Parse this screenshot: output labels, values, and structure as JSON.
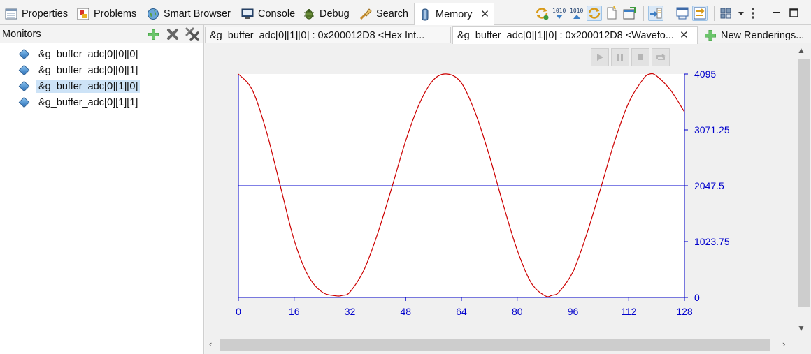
{
  "views": {
    "tabs": [
      {
        "label": "Properties"
      },
      {
        "label": "Problems"
      },
      {
        "label": "Smart Browser"
      },
      {
        "label": "Console"
      },
      {
        "label": "Debug"
      },
      {
        "label": "Search"
      },
      {
        "label": "Memory"
      }
    ]
  },
  "monitors": {
    "title": "Monitors",
    "items": [
      {
        "label": "&g_buffer_adc[0][0][0]"
      },
      {
        "label": "&g_buffer_adc[0][0][1]"
      },
      {
        "label": "&g_buffer_adc[0][1][0]"
      },
      {
        "label": "&g_buffer_adc[0][1][1]"
      }
    ]
  },
  "renderings": {
    "tabs": [
      {
        "label": "&g_buffer_adc[0][1][0] : 0x200012D8 <Hex Int..."
      },
      {
        "label": "&g_buffer_adc[0][1][0] : 0x200012D8 <Wavefo..."
      },
      {
        "label": "New Renderings..."
      }
    ]
  },
  "colors": {
    "waveform": "#cc0000",
    "axis": "#0000cc",
    "selection": "#cde3f7"
  },
  "chart_data": {
    "type": "line",
    "x_ticks": [
      0,
      16,
      32,
      48,
      64,
      80,
      96,
      112,
      128
    ],
    "y_ticks": [
      0,
      1023.75,
      2047.5,
      3071.25,
      4095
    ],
    "xlim": [
      0,
      128
    ],
    "ylim": [
      0,
      4095
    ],
    "y_axis_side": "right",
    "midline": 2047.5,
    "grid": false,
    "series": [
      {
        "x": [
          0,
          4,
          8,
          12,
          16,
          20,
          24,
          28,
          30,
          32,
          36,
          40,
          44,
          48,
          52,
          56,
          60,
          64,
          68,
          72,
          76,
          80,
          84,
          88,
          90,
          92,
          96,
          100,
          104,
          108,
          112,
          116,
          118,
          120,
          124,
          128
        ],
        "y": [
          4095,
          3800,
          3050,
          2050,
          1050,
          400,
          100,
          30,
          40,
          100,
          500,
          1180,
          2010,
          2870,
          3560,
          3990,
          4095,
          3930,
          3380,
          2600,
          1700,
          870,
          270,
          30,
          40,
          100,
          470,
          1170,
          2010,
          2870,
          3570,
          3990,
          4095,
          4060,
          3800,
          3400
        ]
      }
    ]
  }
}
